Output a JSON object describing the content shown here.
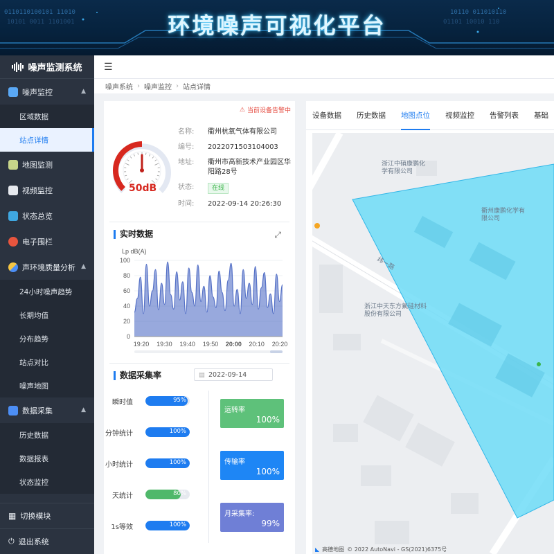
{
  "banner": {
    "title": "环境噪声可视化平台"
  },
  "sidebar": {
    "logo": "噪声监测系统",
    "groups": [
      {
        "label": "噪声监控",
        "icon": "noise-monitor-icon",
        "items": [
          "区域数据",
          "站点详情"
        ]
      },
      {
        "label": "地图监测",
        "icon": "map-icon"
      },
      {
        "label": "视频监控",
        "icon": "camera-icon"
      },
      {
        "label": "状态总览",
        "icon": "cube-icon"
      },
      {
        "label": "电子围栏",
        "icon": "fence-icon"
      },
      {
        "label": "声环境质量分析",
        "icon": "analysis-icon",
        "items": [
          "24小时噪声趋势",
          "长期均值",
          "分布趋势",
          "站点对比",
          "噪声地图"
        ]
      },
      {
        "label": "数据采集",
        "icon": "data-icon",
        "items": [
          "历史数据",
          "数据报表",
          "状态监控"
        ]
      }
    ],
    "switch_module": "切换模块",
    "logout": "退出系统"
  },
  "breadcrumb": [
    "噪声系统",
    "噪声监控",
    "站点详情"
  ],
  "station": {
    "alarm": "当前设备告警中",
    "gauge_value": "50dB",
    "gauge_level": 0.5,
    "name_label": "名称:",
    "name": "衢州杭氧气体有限公司",
    "code_label": "编号:",
    "code": "2022071503104003",
    "address_label": "地址:",
    "address": "衢州市高新技术产业园区华阳路28号",
    "status_label": "状态:",
    "status": "在线",
    "time_label": "时间:",
    "time": "2022-09-14 20:26:30"
  },
  "realtime": {
    "title": "实时数据",
    "chart_data": {
      "type": "area",
      "ylabel": "Lp dB(A)",
      "ylim": [
        0,
        100
      ],
      "yticks": [
        0,
        20,
        40,
        60,
        80,
        100
      ],
      "xticks": [
        "19:20",
        "19:30",
        "19:40",
        "19:50",
        "20:00",
        "20:10",
        "20:20"
      ],
      "x_range": [
        "19:15",
        "20:27"
      ],
      "color": "#5470c6",
      "values": [
        32,
        50,
        78,
        30,
        95,
        40,
        60,
        88,
        35,
        70,
        42,
        98,
        55,
        36,
        85,
        48,
        72,
        30,
        90,
        58,
        40,
        94,
        46,
        66,
        32,
        80,
        52,
        38,
        86,
        58,
        34,
        74,
        96,
        40,
        62,
        30,
        88,
        50,
        70,
        42,
        92,
        36,
        64,
        84,
        38,
        56,
        30,
        82,
        46,
        68
      ]
    }
  },
  "collection": {
    "title": "数据采集率",
    "date": "2022-09-14",
    "rates": [
      {
        "label": "瞬时值",
        "value": "95%",
        "level": 0.95,
        "color": "#1e7cf0"
      },
      {
        "label": "分钟统计",
        "value": "100%",
        "level": 1.0,
        "color": "#1e7cf0"
      },
      {
        "label": "小时统计",
        "value": "100%",
        "level": 1.0,
        "color": "#1e7cf0"
      },
      {
        "label": "天统计",
        "value": "80%",
        "level": 0.8,
        "color": "#4fb86a"
      },
      {
        "label": "1s等效",
        "value": "100%",
        "level": 1.0,
        "color": "#1e7cf0"
      }
    ],
    "cards": [
      {
        "title": "运转率",
        "value": "100%",
        "color": "#5ec17a"
      },
      {
        "title": "传输率",
        "value": "100%",
        "color": "#1e86f5"
      },
      {
        "title": "月采集率:",
        "value": "99%",
        "color": "#6f7fd6"
      }
    ]
  },
  "tabs": [
    "设备数据",
    "历史数据",
    "地图点位",
    "视频监控",
    "告警列表",
    "基础"
  ],
  "active_tab": 2,
  "map": {
    "pois": [
      "浙江中硝康鹏化学有限公司",
      "衢州康鹏化学有限公司",
      "浙江中天东方氟硅材料股份有限公司",
      "纬一路"
    ],
    "provider": "高德地图",
    "copyright": "© 2022 AutoNavi - GS(2021)6375号"
  }
}
